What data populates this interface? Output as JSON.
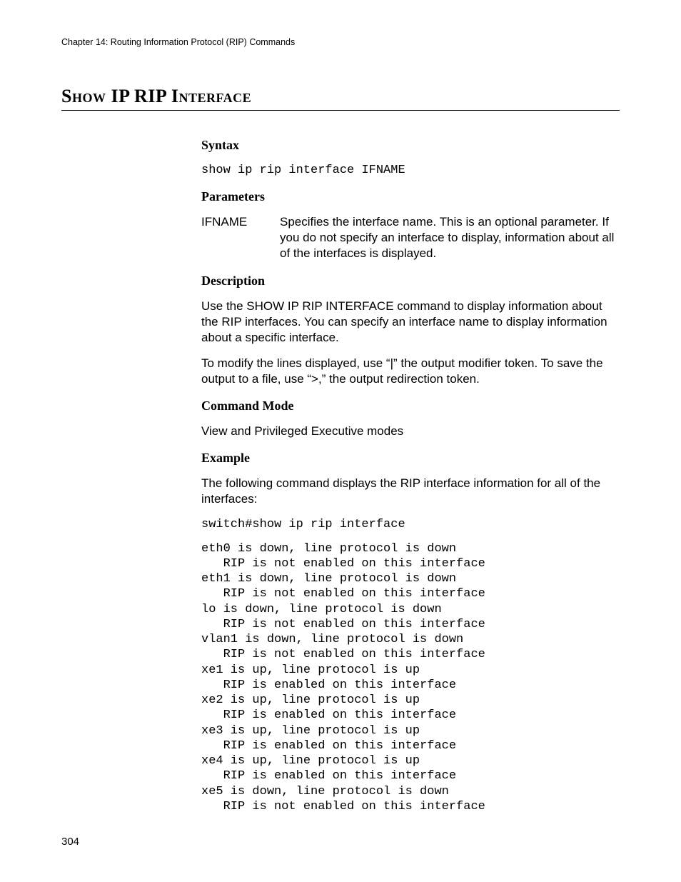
{
  "header": {
    "running": "Chapter 14: Routing Information Protocol (RIP) Commands"
  },
  "title": "Show IP RIP Interface",
  "syntax": {
    "heading": "Syntax",
    "command": "show ip rip interface IFNAME"
  },
  "parameters": {
    "heading": "Parameters",
    "items": [
      {
        "name": "IFNAME",
        "desc": "Specifies the interface name. This is an optional parameter. If you do not specify an interface to display, information about all of the interfaces is displayed."
      }
    ]
  },
  "description": {
    "heading": "Description",
    "para1": "Use the SHOW IP RIP INTERFACE command to display information about the RIP interfaces. You can specify an interface name to display information about a specific interface.",
    "para2": "To modify the lines displayed, use “|” the output modifier token. To save the output to a file, use “>,” the output redirection token."
  },
  "command_mode": {
    "heading": "Command Mode",
    "text": "View and Privileged Executive modes"
  },
  "example": {
    "heading": "Example",
    "intro": "The following command displays the RIP interface information for all of the interfaces:",
    "cmd": "switch#show ip rip interface",
    "output": "eth0 is down, line protocol is down\n   RIP is not enabled on this interface\neth1 is down, line protocol is down\n   RIP is not enabled on this interface\nlo is down, line protocol is down\n   RIP is not enabled on this interface\nvlan1 is down, line protocol is down\n   RIP is not enabled on this interface\nxe1 is up, line protocol is up\n   RIP is enabled on this interface\nxe2 is up, line protocol is up\n   RIP is enabled on this interface\nxe3 is up, line protocol is up\n   RIP is enabled on this interface\nxe4 is up, line protocol is up\n   RIP is enabled on this interface\nxe5 is down, line protocol is down\n   RIP is not enabled on this interface"
  },
  "page_number": "304"
}
